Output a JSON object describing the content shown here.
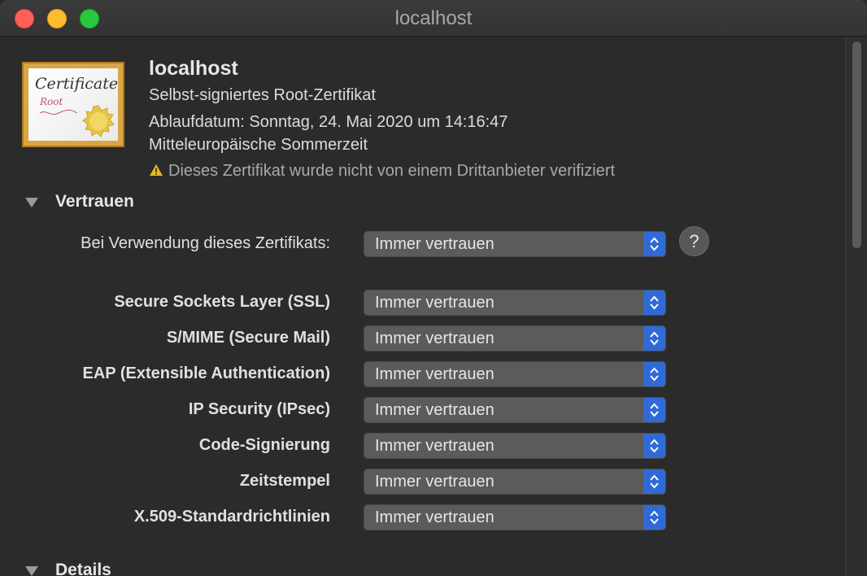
{
  "window": {
    "title": "localhost"
  },
  "certificate": {
    "icon_word": "Certificate",
    "icon_sub": "Root",
    "name": "localhost",
    "type": "Selbst-signiertes Root-Zertifikat",
    "expiry": "Ablaufdatum: Sonntag, 24. Mai 2020 um 14:16:47",
    "timezone": "Mitteleuropäische Sommerzeit",
    "warning": "Dieses Zertifikat wurde nicht von einem Drittanbieter verifiziert"
  },
  "trust": {
    "section_label": "Vertrauen",
    "main_label": "Bei Verwendung dieses Zertifikats:",
    "main_value": "Immer vertrauen",
    "help": "?",
    "rows": [
      {
        "label": "Secure Sockets Layer (SSL)",
        "value": "Immer vertrauen"
      },
      {
        "label": "S/MIME (Secure Mail)",
        "value": "Immer vertrauen"
      },
      {
        "label": "EAP (Extensible Authentication)",
        "value": "Immer vertrauen"
      },
      {
        "label": "IP Security (IPsec)",
        "value": "Immer vertrauen"
      },
      {
        "label": "Code-Signierung",
        "value": "Immer vertrauen"
      },
      {
        "label": "Zeitstempel",
        "value": "Immer vertrauen"
      },
      {
        "label": "X.509-Standardrichtlinien",
        "value": "Immer vertrauen"
      }
    ]
  },
  "details": {
    "section_label": "Details"
  },
  "colors": {
    "accent": "#2f6ad6",
    "background": "#2b2b2b",
    "warning": "#e8b923"
  },
  "icons": [
    "close-icon",
    "minimize-icon",
    "maximize-icon",
    "certificate-icon",
    "warning-icon",
    "disclosure-triangle-icon",
    "updown-chevron-icon",
    "help-icon"
  ]
}
